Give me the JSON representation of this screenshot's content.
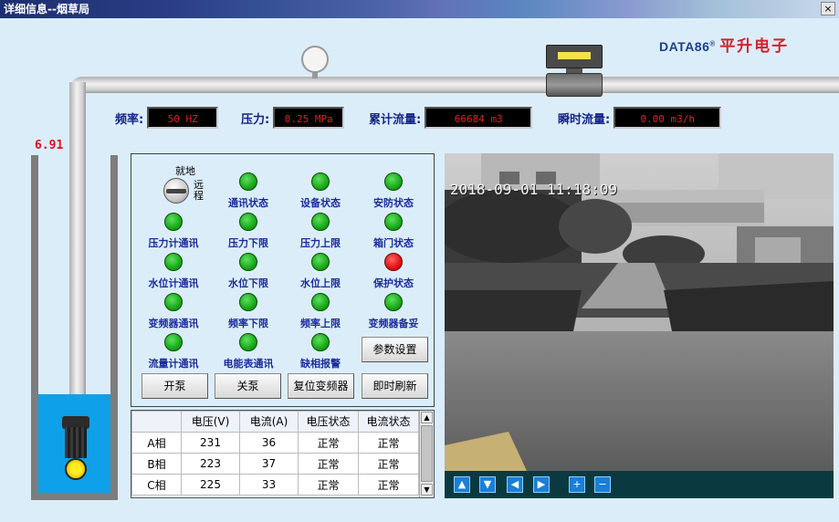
{
  "window": {
    "title": "详细信息--烟草局",
    "close_label": "×"
  },
  "logo": {
    "brand": "DATA86",
    "registered": "®",
    "company": "平升电子"
  },
  "readouts": {
    "frequency": {
      "label": "频率:",
      "value": "50 HZ"
    },
    "pressure": {
      "label": "压力:",
      "value": "0.25 MPa"
    },
    "total_flow": {
      "label": "累计流量:",
      "value": "66684 m3"
    },
    "instant_flow": {
      "label": "瞬时流量:",
      "value": "0.00 m3/h"
    }
  },
  "water_level": "6.91",
  "switch": {
    "label_top": "就地",
    "label_side": "远程"
  },
  "indicators": [
    {
      "label": "通讯状态",
      "state": "green"
    },
    {
      "label": "设备状态",
      "state": "green"
    },
    {
      "label": "安防状态",
      "state": "green"
    },
    {
      "label": "压力计通讯",
      "state": "green"
    },
    {
      "label": "压力下限",
      "state": "green"
    },
    {
      "label": "压力上限",
      "state": "green"
    },
    {
      "label": "箱门状态",
      "state": "green"
    },
    {
      "label": "水位计通讯",
      "state": "green"
    },
    {
      "label": "水位下限",
      "state": "green"
    },
    {
      "label": "水位上限",
      "state": "green"
    },
    {
      "label": "保护状态",
      "state": "red"
    },
    {
      "label": "变频器通讯",
      "state": "green"
    },
    {
      "label": "频率下限",
      "state": "green"
    },
    {
      "label": "频率上限",
      "state": "green"
    },
    {
      "label": "变频器备妥",
      "state": "green"
    },
    {
      "label": "流量计通讯",
      "state": "green"
    },
    {
      "label": "电能表通讯",
      "state": "green"
    },
    {
      "label": "缺相报警",
      "state": "green"
    }
  ],
  "buttons": {
    "params": "参数设置",
    "start_pump": "开泵",
    "stop_pump": "关泵",
    "reset_inverter": "复位变频器",
    "refresh": "即时刷新"
  },
  "table": {
    "headers": [
      "",
      "电压(V)",
      "电流(A)",
      "电压状态",
      "电流状态"
    ],
    "rows": [
      [
        "A相",
        "231",
        "36",
        "正常",
        "正常"
      ],
      [
        "B相",
        "223",
        "37",
        "正常",
        "正常"
      ],
      [
        "C相",
        "225",
        "33",
        "正常",
        "正常"
      ]
    ]
  },
  "video": {
    "timestamp": "2018-09-01 11:18:09",
    "controls": [
      "up",
      "down",
      "left",
      "right",
      "zoom-in",
      "zoom-out"
    ]
  },
  "colors": {
    "led_green": "#17a917",
    "led_red": "#e01010",
    "label_blue": "#1a2c9c",
    "readout_red": "#e02020",
    "water": "#0ea0e8"
  }
}
